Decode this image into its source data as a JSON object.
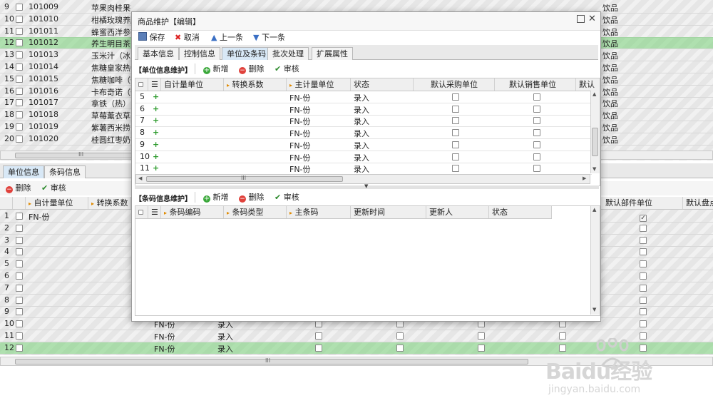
{
  "background_grid": {
    "rows": [
      {
        "num": "9",
        "code": "101009",
        "name": "苹果肉桂果茶",
        "tail": "饮品"
      },
      {
        "num": "10",
        "code": "101010",
        "name": "柑橘玫瑰养颜",
        "tail": "饮品"
      },
      {
        "num": "11",
        "code": "101011",
        "name": "蜂蜜西洋参茶",
        "tail": "饮品"
      },
      {
        "num": "12",
        "code": "101012",
        "name": "养生明目茶",
        "tail": "饮品"
      },
      {
        "num": "13",
        "code": "101013",
        "name": "玉米汁（冰",
        "tail": "饮品"
      },
      {
        "num": "14",
        "code": "101014",
        "name": "焦糖皇家热饮",
        "tail": "饮品"
      },
      {
        "num": "15",
        "code": "101015",
        "name": "焦糖咖啡（热",
        "tail": "饮品"
      },
      {
        "num": "16",
        "code": "101016",
        "name": "卡布奇诺（热",
        "tail": "饮品"
      },
      {
        "num": "17",
        "code": "101017",
        "name": "拿铁（热）",
        "tail": "饮品"
      },
      {
        "num": "18",
        "code": "101018",
        "name": "草莓薰衣草茶",
        "tail": "饮品"
      },
      {
        "num": "19",
        "code": "101019",
        "name": "紫薯西米捞",
        "tail": "饮品"
      },
      {
        "num": "20",
        "code": "101020",
        "name": "桂圆红枣奶茶",
        "tail": "饮品"
      }
    ],
    "selected_row": "12",
    "scroll_grip": "III"
  },
  "bottom_tabs": [
    "单位信息",
    "条码信息"
  ],
  "bottom_toolbar": {
    "delete": "删除",
    "audit": "审核"
  },
  "bottom_grid": {
    "headers": [
      "自计量单位",
      "转换系数"
    ],
    "right_headers": [
      "默认部件单位",
      "默认盘点"
    ],
    "first_row_unit": "FN-份",
    "row_numbers": [
      "1",
      "2",
      "3",
      "4",
      "5",
      "6",
      "7",
      "8",
      "9",
      "10",
      "11",
      "12"
    ],
    "tail_rows": [
      {
        "num": "10",
        "unit": "FN-份",
        "status": "录入"
      },
      {
        "num": "11",
        "unit": "FN-份",
        "status": "录入"
      },
      {
        "num": "12",
        "unit": "FN-份",
        "status": "录入"
      }
    ],
    "scroll_grip": "III"
  },
  "dialog": {
    "title": "商品维护【编辑】",
    "toolbar": {
      "save": "保存",
      "cancel": "取消",
      "prev": "上一条",
      "next": "下一条"
    },
    "tabs": [
      "基本信息",
      "控制信息",
      "单位及条码",
      "批次处理",
      "扩展属性"
    ],
    "active_tab": "单位及条码",
    "unit_section": {
      "title": "【单位信息维护】",
      "add": "新增",
      "delete": "删除",
      "audit": "审核",
      "headers": [
        "自计量单位",
        "转换系数",
        "主计量单位",
        "状态",
        "默认采购单位",
        "默认销售单位",
        "默认"
      ],
      "rows": [
        {
          "num": "5",
          "main_unit": "FN-份",
          "status": "录入"
        },
        {
          "num": "6",
          "main_unit": "FN-份",
          "status": "录入"
        },
        {
          "num": "7",
          "main_unit": "FN-份",
          "status": "录入"
        },
        {
          "num": "8",
          "main_unit": "FN-份",
          "status": "录入"
        },
        {
          "num": "9",
          "main_unit": "FN-份",
          "status": "录入"
        },
        {
          "num": "10",
          "main_unit": "FN-份",
          "status": "录入"
        },
        {
          "num": "11",
          "main_unit": "FN-份",
          "status": "录入"
        }
      ],
      "scroll_grip": "III"
    },
    "barcode_section": {
      "title": "【条码信息维护】",
      "add": "新增",
      "delete": "删除",
      "audit": "审核",
      "headers": [
        "条码编码",
        "条码类型",
        "主条码",
        "更新时间",
        "更新人",
        "状态"
      ]
    }
  },
  "watermark": {
    "brand": "Baidu经验",
    "url": "jingyan.baidu.com"
  },
  "colors": {
    "selected_row": "#9fdc9a",
    "dialog_border": "#9a9a9a",
    "add_green": "#3aa83a",
    "delete_red": "#e0413b"
  }
}
